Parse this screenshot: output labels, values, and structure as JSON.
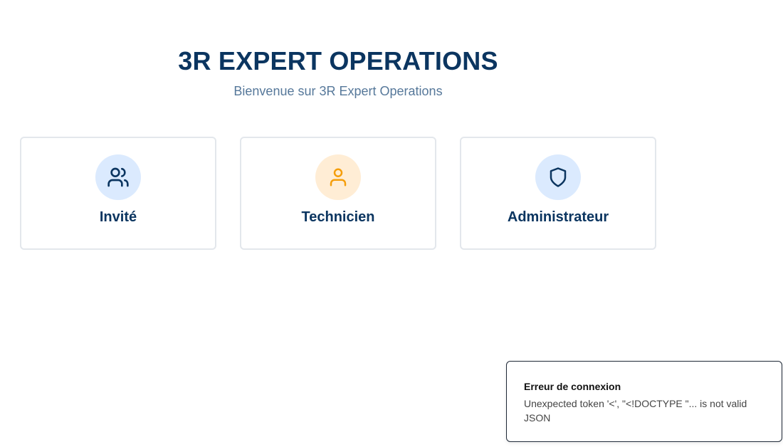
{
  "header": {
    "title": "3R EXPERT OPERATIONS",
    "subtitle": "Bienvenue sur 3R Expert Operations"
  },
  "roles": [
    {
      "label": "Invité",
      "icon": "users-icon",
      "icon_color": "#0b3560",
      "bg_color": "#dbeafe"
    },
    {
      "label": "Technicien",
      "icon": "user-icon",
      "icon_color": "#f59e0b",
      "bg_color": "#ffedd5"
    },
    {
      "label": "Administrateur",
      "icon": "shield-icon",
      "icon_color": "#0b3560",
      "bg_color": "#dbeafe"
    }
  ],
  "toast": {
    "title": "Erreur de connexion",
    "message": "Unexpected token '<', \"<!DOCTYPE \"... is not valid JSON"
  },
  "colors": {
    "brand": "#0b3560",
    "accent_orange": "#f59e0b"
  }
}
